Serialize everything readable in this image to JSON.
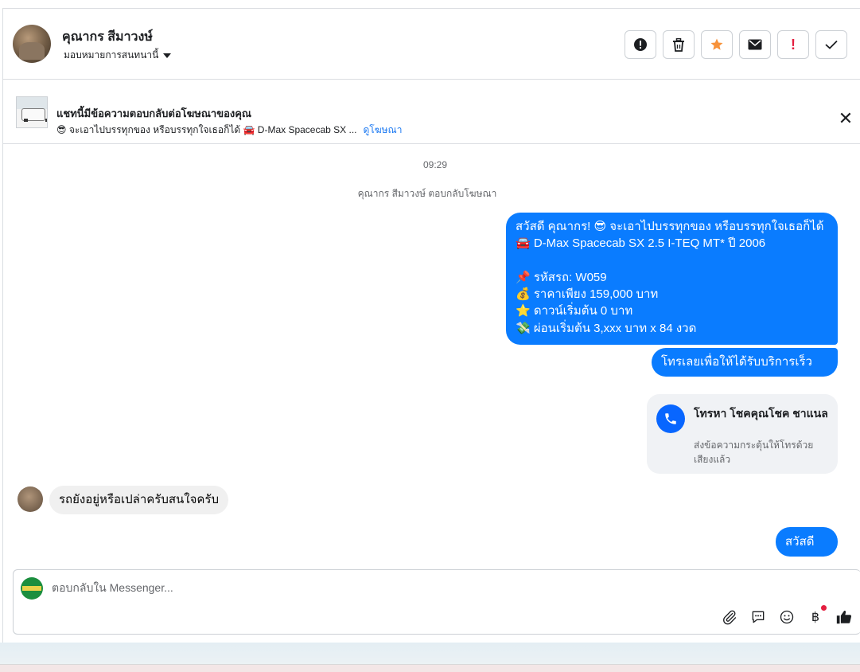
{
  "header": {
    "contact_name": "คุณากร สีมาวงษ์",
    "assign_label": "มอบหมายการสนทนานี้",
    "actions": [
      {
        "name": "report-icon",
        "glyph": "❗"
      },
      {
        "name": "trash-icon",
        "glyph": "🗑"
      },
      {
        "name": "star-icon",
        "glyph": "★"
      },
      {
        "name": "envelope-icon",
        "glyph": "✉"
      },
      {
        "name": "exclamation-icon",
        "glyph": "!"
      },
      {
        "name": "check-icon",
        "glyph": "✓"
      }
    ]
  },
  "ad_banner": {
    "title": "แชทนี้มีข้อความตอบกลับต่อโฆษณาของคุณ",
    "snippet": "😎 จะเอาไปบรรทุกของ หรือบรรทุกใจเธอก็ได้ 🚘 D-Max Spacecab SX ...",
    "link": "ดูโฆษณา",
    "close_glyph": "✕"
  },
  "chat": {
    "time": "09:29",
    "system_message": "คุณากร สีมาวงษ์ ตอบกลับโฆษณา",
    "outgoing_ad_lines": [
      "สวัสดี คุณากร! 😎 จะเอาไปบรรทุกของ หรือบรรทุกใจเธอก็ได้",
      "🚘 D-Max Spacecab SX 2.5 I-TEQ MT* ปี 2006",
      "",
      "📌 รหัสรถ: W059",
      "💰 ราคาเพียง 159,000 บาท",
      "⭐ ดาวน์เริ่มต้น 0 บาท",
      "💸 ผ่อนเริ่มต้น 3,xxx บาท x 84 งวด"
    ],
    "outgoing_call_prompt": "โทรเลยเพื่อให้ได้รับบริการเร็วขึ้น",
    "call_card": {
      "title": "โทรหา โชคคุณโชค ชาแนล",
      "subtitle": "ส่งข้อความกระตุ้นให้โทรด้วยเสียงแล้ว"
    },
    "incoming_message": "รถยังอยู่หรือเปล่าครับสนใจครับ",
    "outgoing_reply": "สวัสดีคะ"
  },
  "composer": {
    "placeholder": "ตอบกลับใน Messenger...",
    "tools": [
      "attach-icon",
      "quick-reply-icon",
      "emoji-icon",
      "payment-icon",
      "like-icon"
    ],
    "payment_glyph": "฿"
  },
  "colors": {
    "accent": "#0a7cff",
    "call_icon": "#0866ff",
    "star": "#f7923a",
    "exclamation": "#e41e3f"
  }
}
